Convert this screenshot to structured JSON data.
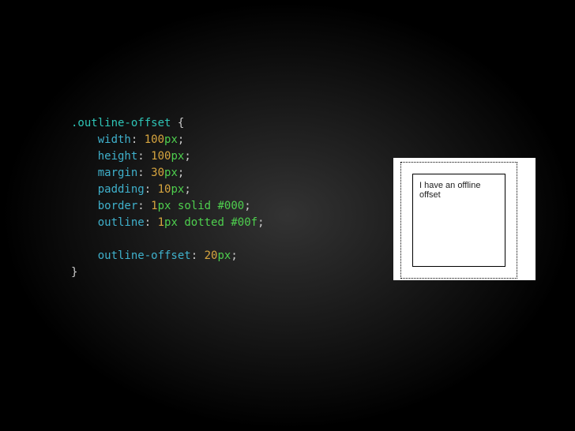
{
  "code": {
    "selector": ".outline-offset",
    "open_brace": "{",
    "close_brace": "}",
    "lines": [
      {
        "property": "width",
        "colon": ":",
        "value_num": "100",
        "unit": "px",
        "post": "",
        "semi": ";"
      },
      {
        "property": "height",
        "colon": ":",
        "value_num": "100",
        "unit": "px",
        "post": "",
        "semi": ";"
      },
      {
        "property": "margin",
        "colon": ":",
        "value_num": "30",
        "unit": "px",
        "post": "",
        "semi": ";"
      },
      {
        "property": "padding",
        "colon": ":",
        "value_num": "10",
        "unit": "px",
        "post": "",
        "semi": ";"
      },
      {
        "property": "border",
        "colon": ":",
        "value_num": "1",
        "unit": "px",
        "post_keyword": "solid",
        "hex": "#000",
        "semi": ";"
      },
      {
        "property": "outline",
        "colon": ":",
        "value_num": "1",
        "unit": "px",
        "post_keyword": "dotted",
        "hex": "#00f",
        "semi": ";"
      },
      {
        "blank": true
      },
      {
        "property": "outline-offset",
        "colon": ":",
        "value_num": "20",
        "unit": "px",
        "post": "",
        "semi": ";"
      }
    ]
  },
  "demo": {
    "box_text": "I have an offline offset"
  }
}
